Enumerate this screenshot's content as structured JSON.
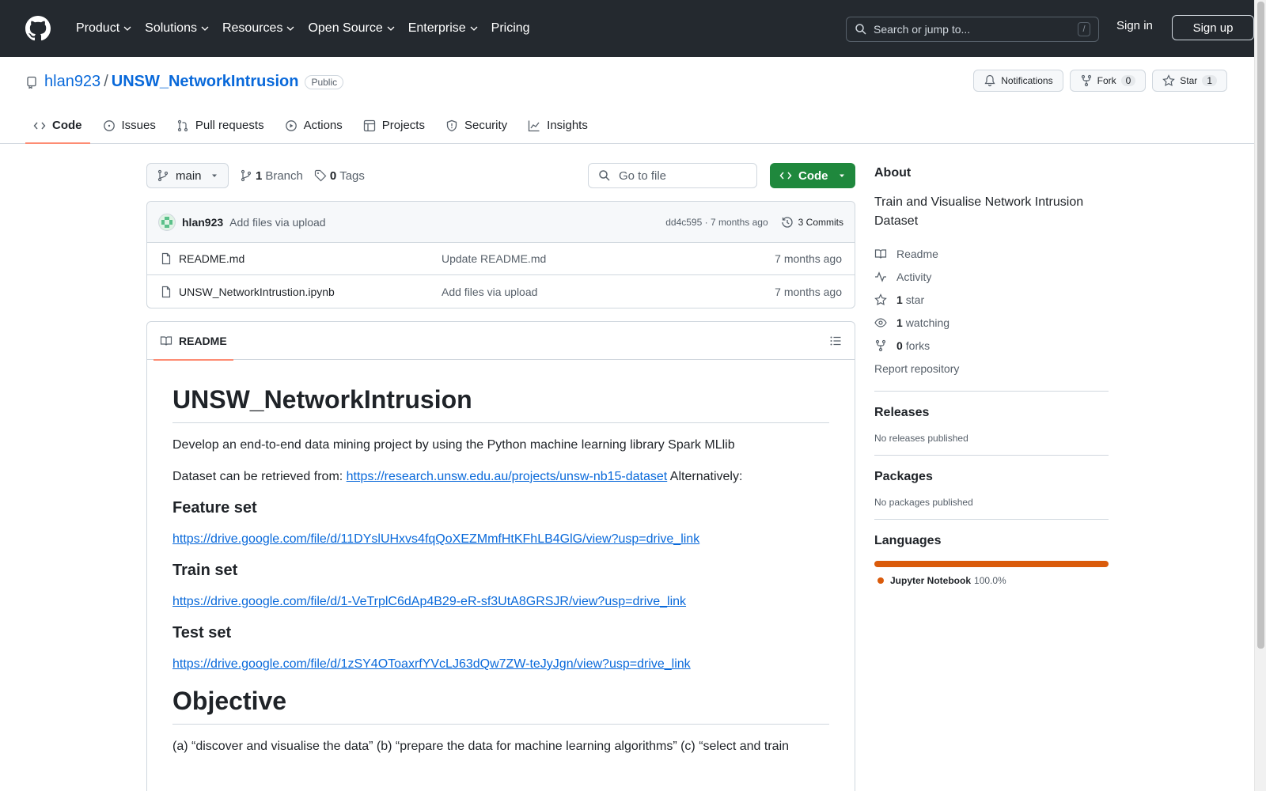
{
  "header": {
    "nav": [
      "Product",
      "Solutions",
      "Resources",
      "Open Source",
      "Enterprise",
      "Pricing"
    ],
    "search_placeholder": "Search or jump to...",
    "search_shortcut": "/",
    "sign_in": "Sign in",
    "sign_up": "Sign up"
  },
  "repo": {
    "owner": "hlan923",
    "separator": "/",
    "name": "UNSW_NetworkIntrusion",
    "visibility": "Public",
    "notifications_label": "Notifications",
    "fork_label": "Fork",
    "fork_count": "0",
    "star_label": "Star",
    "star_count": "1",
    "tabs": [
      "Code",
      "Issues",
      "Pull requests",
      "Actions",
      "Projects",
      "Security",
      "Insights"
    ]
  },
  "toolbar": {
    "branch": "main",
    "branch_count": "1",
    "branch_label": "Branch",
    "tag_count": "0",
    "tag_label": "Tags",
    "goto_placeholder": "Go to file",
    "code_button": "Code"
  },
  "commit": {
    "author": "hlan923",
    "message": "Add files via upload",
    "meta": "dd4c595 · 7 months ago",
    "commits_label": "3 Commits"
  },
  "files": [
    {
      "name": "README.md",
      "message": "Update README.md",
      "date": "7 months ago"
    },
    {
      "name": "UNSW_NetworkIntrustion.ipynb",
      "message": "Add files via upload",
      "date": "7 months ago"
    }
  ],
  "readme": {
    "tab_label": "README",
    "title": "UNSW_NetworkIntrusion",
    "intro": "Develop an end-to-end data mining project by using the Python machine learning library Spark MLlib",
    "dataset_prefix": "Dataset can be retrieved from: ",
    "dataset_link": "https://research.unsw.edu.au/projects/unsw-nb15-dataset",
    "dataset_suffix": " Alternatively:",
    "feature_heading": "Feature set",
    "feature_link": "https://drive.google.com/file/d/11DYslUHxvs4fqQoXEZMmfHtKFhLB4GlG/view?usp=drive_link",
    "train_heading": "Train set",
    "train_link": "https://drive.google.com/file/d/1-VeTrplC6dAp4B29-eR-sf3UtA8GRSJR/view?usp=drive_link",
    "test_heading": "Test set",
    "test_link": "https://drive.google.com/file/d/1zSY4OToaxrfYVcLJ63dQw7ZW-teJyJgn/view?usp=drive_link",
    "objective_heading": "Objective",
    "objective_text": "(a) “discover and visualise the data” (b) “prepare the data for machine learning algorithms” (c) “select and train"
  },
  "sidebar": {
    "about_heading": "About",
    "description": "Train and Visualise Network Intrusion Dataset",
    "readme": "Readme",
    "activity": "Activity",
    "stars_count": "1",
    "stars_label": "star",
    "watching_count": "1",
    "watching_label": "watching",
    "forks_count": "0",
    "forks_label": "forks",
    "report": "Report repository",
    "releases_heading": "Releases",
    "releases_text": "No releases published",
    "packages_heading": "Packages",
    "packages_text": "No packages published",
    "languages_heading": "Languages",
    "language_name": "Jupyter Notebook",
    "language_pct": "100.0%"
  },
  "colors": {
    "header_bg": "#24292f",
    "accent_link": "#0969da",
    "code_button": "#1f883d",
    "tab_underline": "#fd8c73",
    "language_jupyter": "#da5b0b"
  }
}
